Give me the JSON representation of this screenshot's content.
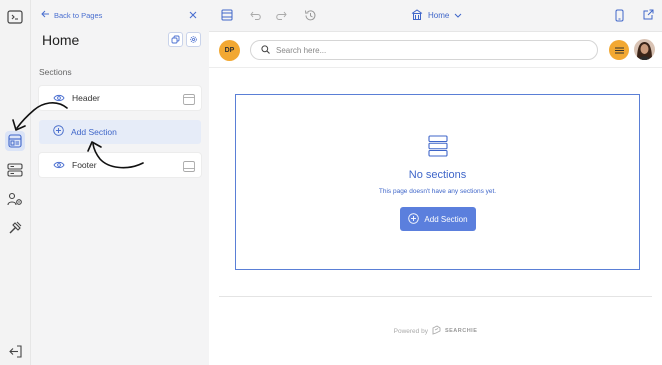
{
  "panel": {
    "back_label": "Back to Pages",
    "page_title": "Home",
    "sections_label": "Sections",
    "sections": [
      {
        "label": "Header"
      },
      {
        "label": "Add Section"
      },
      {
        "label": "Footer"
      }
    ]
  },
  "toolbar": {
    "page_selector": "Home"
  },
  "preview": {
    "avatar_initials": "DP",
    "search_placeholder": "Search here...",
    "empty_title": "No sections",
    "empty_subtitle": "This page doesn't have any sections yet.",
    "add_section_button": "Add Section",
    "powered_by": "Powered by",
    "brand": "SEARCHIE"
  },
  "colors": {
    "accent": "#3f66c9",
    "button": "#5b7fdd",
    "avatar": "#f2a832",
    "panel_bg": "#f4f4f5"
  },
  "icons": {
    "rail": [
      "video-dashboard-icon",
      "sections-icon",
      "list-icon",
      "users-settings-icon",
      "tools-icon",
      "exit-icon"
    ],
    "toolbar": [
      "layout-icon",
      "undo-icon",
      "redo-icon",
      "history-icon",
      "home-icon",
      "mobile-icon",
      "open-external-icon"
    ]
  }
}
